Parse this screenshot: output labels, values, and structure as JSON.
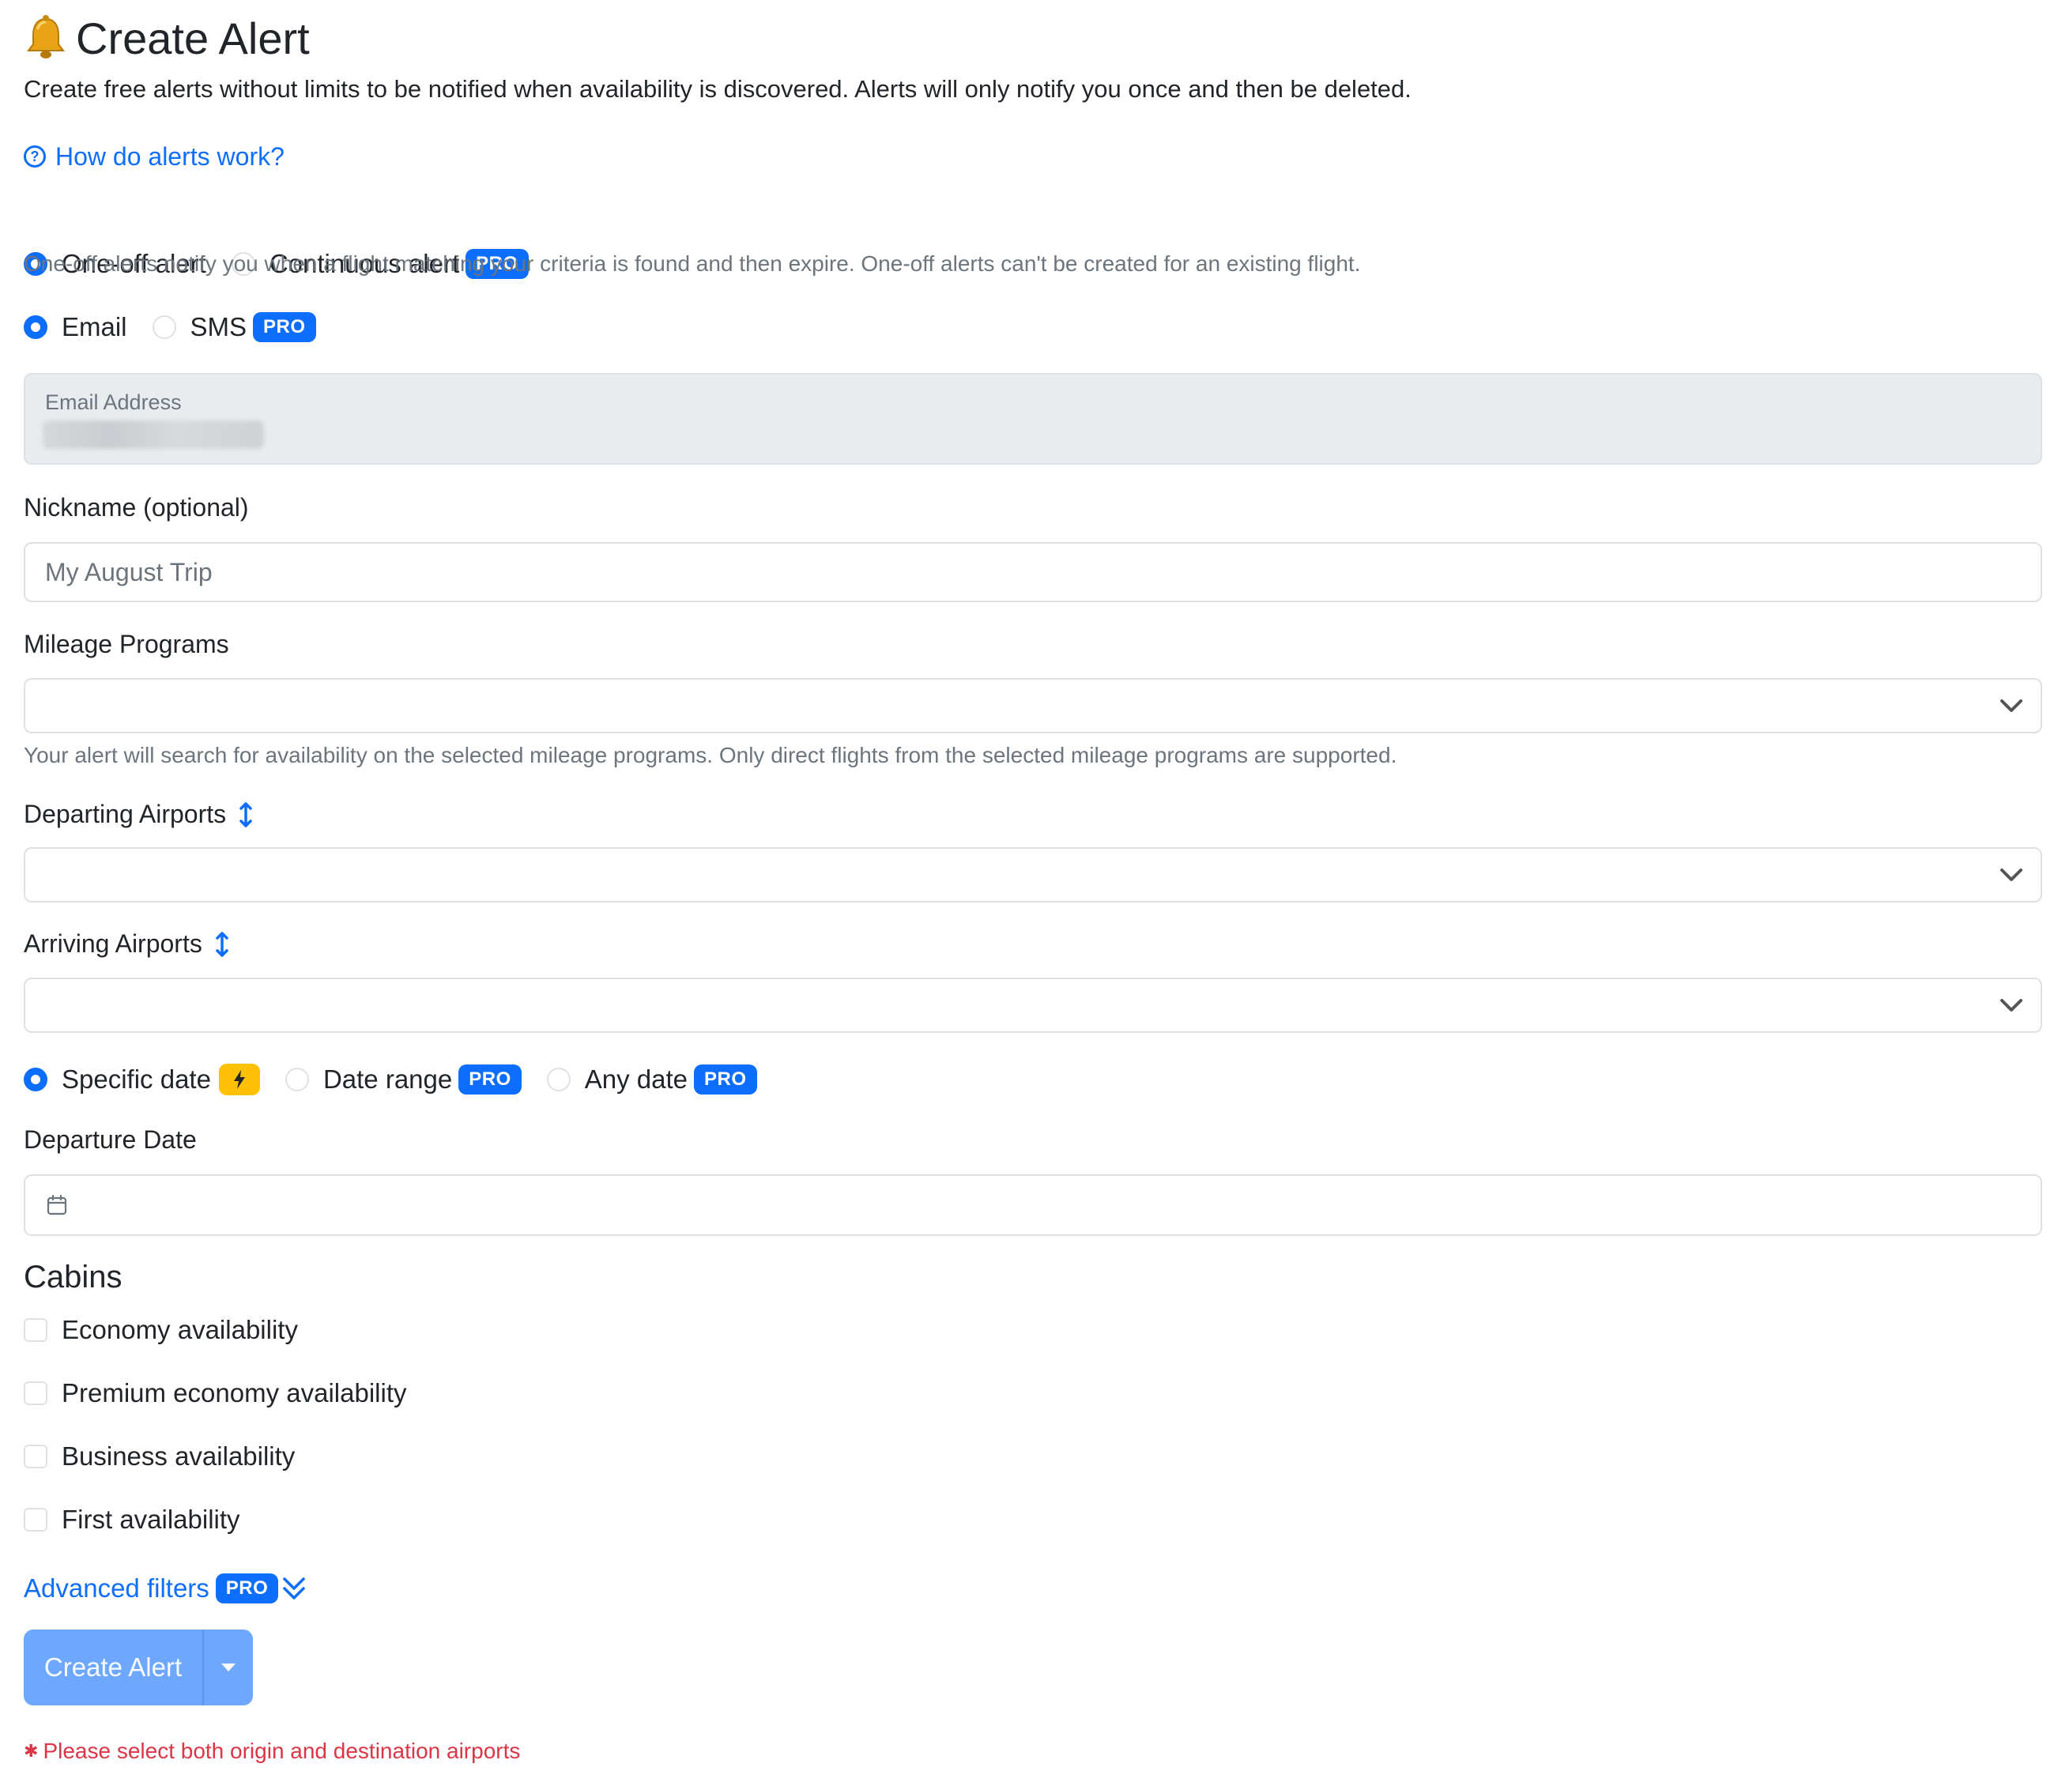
{
  "header": {
    "title": "Create Alert",
    "lead": "Create free alerts without limits to be notified when availability is discovered. Alerts will only notify you once and then be deleted."
  },
  "help_link": "How do alerts work?",
  "alert_type": {
    "options": [
      "One-off alert",
      "Continuous alert"
    ],
    "selected": "One-off alert",
    "pro_badge": "PRO",
    "help": "One-off alerts notify you when a flight matching your criteria is found and then expire. One-off alerts can't be created for an existing flight."
  },
  "notify_via": {
    "options": [
      "Email",
      "SMS"
    ],
    "selected": "Email",
    "pro_badge": "PRO"
  },
  "email": {
    "label": "Email Address"
  },
  "nickname": {
    "label": "Nickname (optional)",
    "placeholder": "My August Trip"
  },
  "mileage": {
    "label": "Mileage Programs",
    "help": "Your alert will search for availability on the selected mileage programs. Only direct flights from the selected mileage programs are supported."
  },
  "departing": {
    "label": "Departing Airports"
  },
  "arriving": {
    "label": "Arriving Airports"
  },
  "date_mode": {
    "options": [
      "Specific date",
      "Date range",
      "Any date"
    ],
    "selected": "Specific date",
    "pro_badge": "PRO"
  },
  "departure_date": {
    "label": "Departure Date"
  },
  "cabins": {
    "title": "Cabins",
    "items": [
      "Economy availability",
      "Premium economy availability",
      "Business availability",
      "First availability"
    ]
  },
  "advanced": {
    "label": "Advanced filters",
    "pro_badge": "PRO"
  },
  "submit": {
    "label": "Create Alert"
  },
  "error": "Please select both origin and destination airports",
  "colors": {
    "primary": "#0d6efd",
    "primary_disabled": "#6ea8fe",
    "warning": "#ffc107",
    "danger": "#dc3545",
    "muted": "#6c757d"
  }
}
